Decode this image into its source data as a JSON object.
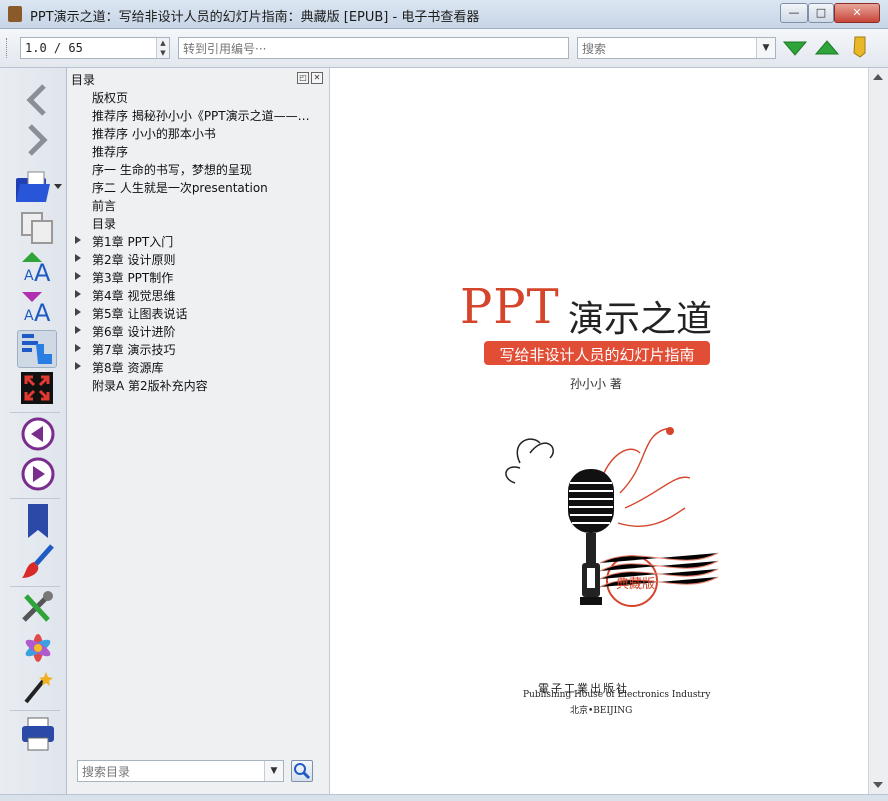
{
  "window": {
    "title": "PPT演示之道：写给非设计人员的幻灯片指南：典藏版 [EPUB] - 电子书查看器",
    "minimize": "—",
    "maximize": "□",
    "close": "✕"
  },
  "toolbar": {
    "page_value": "1.0 / 65",
    "goto_ref_placeholder": "转到引用编号···",
    "search_placeholder": "搜索",
    "icons": [
      "next-match-icon",
      "previous-match-icon",
      "bookmark-tag-icon"
    ]
  },
  "leftbar": {
    "icons": [
      "back-arrow-icon",
      "forward-arrow-icon",
      "open-folder-icon",
      "copy-icon",
      "increase-font-icon",
      "decrease-font-icon",
      "toc-toggle-icon",
      "fullscreen-icon",
      "previous-page-icon",
      "next-page-icon",
      "bookmark-icon",
      "brush-icon",
      "tools-icon",
      "themes-icon",
      "magic-wand-icon",
      "print-icon"
    ]
  },
  "toc": {
    "title": "目录",
    "float_button": "◰",
    "close_button": "✕",
    "items": [
      {
        "label": "版权页",
        "expandable": false
      },
      {
        "label": "推荐序 揭秘孙小小《PPT演示之道——写给非设计人员的幻灯片指南》",
        "expandable": false
      },
      {
        "label": "推荐序 小小的那本小书",
        "expandable": false
      },
      {
        "label": "推荐序",
        "expandable": false
      },
      {
        "label": "序一 生命的书写，梦想的呈现",
        "expandable": false
      },
      {
        "label": "序二 人生就是一次presentation",
        "expandable": false
      },
      {
        "label": "前言",
        "expandable": false
      },
      {
        "label": "目录",
        "expandable": false
      },
      {
        "label": "第1章 PPT入门",
        "expandable": true
      },
      {
        "label": "第2章 设计原则",
        "expandable": true
      },
      {
        "label": "第3章 PPT制作",
        "expandable": true
      },
      {
        "label": "第4章 视觉思维",
        "expandable": true
      },
      {
        "label": "第5章 让图表说话",
        "expandable": true
      },
      {
        "label": "第6章 设计进阶",
        "expandable": true
      },
      {
        "label": "第7章 演示技巧",
        "expandable": true
      },
      {
        "label": "第8章 资源库",
        "expandable": true
      },
      {
        "label": "附录A 第2版补充内容",
        "expandable": false
      }
    ],
    "search_placeholder": "搜索目录"
  },
  "cover": {
    "title_ppt": "PPT",
    "title_rest": "演示之道",
    "subtitle": "写给非设计人员的幻灯片指南",
    "author": "孙小小 著",
    "stamp": "典藏版",
    "publisher_cn": "電子工業出版社",
    "publisher_en": "Publishing House of Electronics Industry",
    "city": "北京•BEIJING"
  },
  "colors": {
    "accent_red": "#d5452b",
    "nav_green": "#2ea43a",
    "nav_purple": "#7b2d8e"
  }
}
